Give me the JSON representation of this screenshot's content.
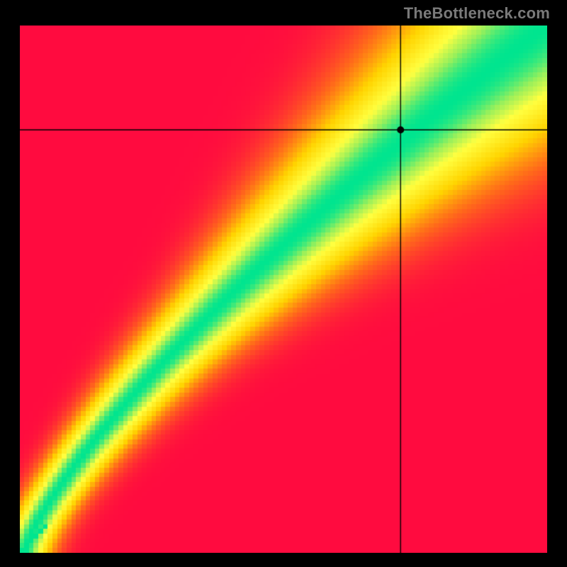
{
  "watermark": "TheBottleneck.com",
  "chart_data": {
    "type": "heatmap",
    "title": "",
    "xlabel": "",
    "ylabel": "",
    "xlim": [
      0,
      1
    ],
    "ylim": [
      0,
      1
    ],
    "crosshair": {
      "x": 0.722,
      "y": 0.802
    },
    "point": {
      "x": 0.722,
      "y": 0.802,
      "radius_px": 5
    },
    "ridge": {
      "description": "Green optimum ridge that is roughly diagonal but supra-linear in the middle (k ~1.3) so for mid x the best y is above y=x; broader spread at high x,y.",
      "exponent": 1.3,
      "width_base": 0.045,
      "width_growth": 0.19,
      "origin_nudge": 0.01,
      "dot_in_green": true
    },
    "colormap": {
      "stops": [
        {
          "t": 0.0,
          "color": "#ff0b3f"
        },
        {
          "t": 0.25,
          "color": "#ff6a1a"
        },
        {
          "t": 0.5,
          "color": "#ffd400"
        },
        {
          "t": 0.75,
          "color": "#ffff40"
        },
        {
          "t": 0.88,
          "color": "#9cf05a"
        },
        {
          "t": 1.0,
          "color": "#00e58f"
        }
      ]
    },
    "grid": {
      "pixels": 112,
      "block_look": true
    }
  }
}
